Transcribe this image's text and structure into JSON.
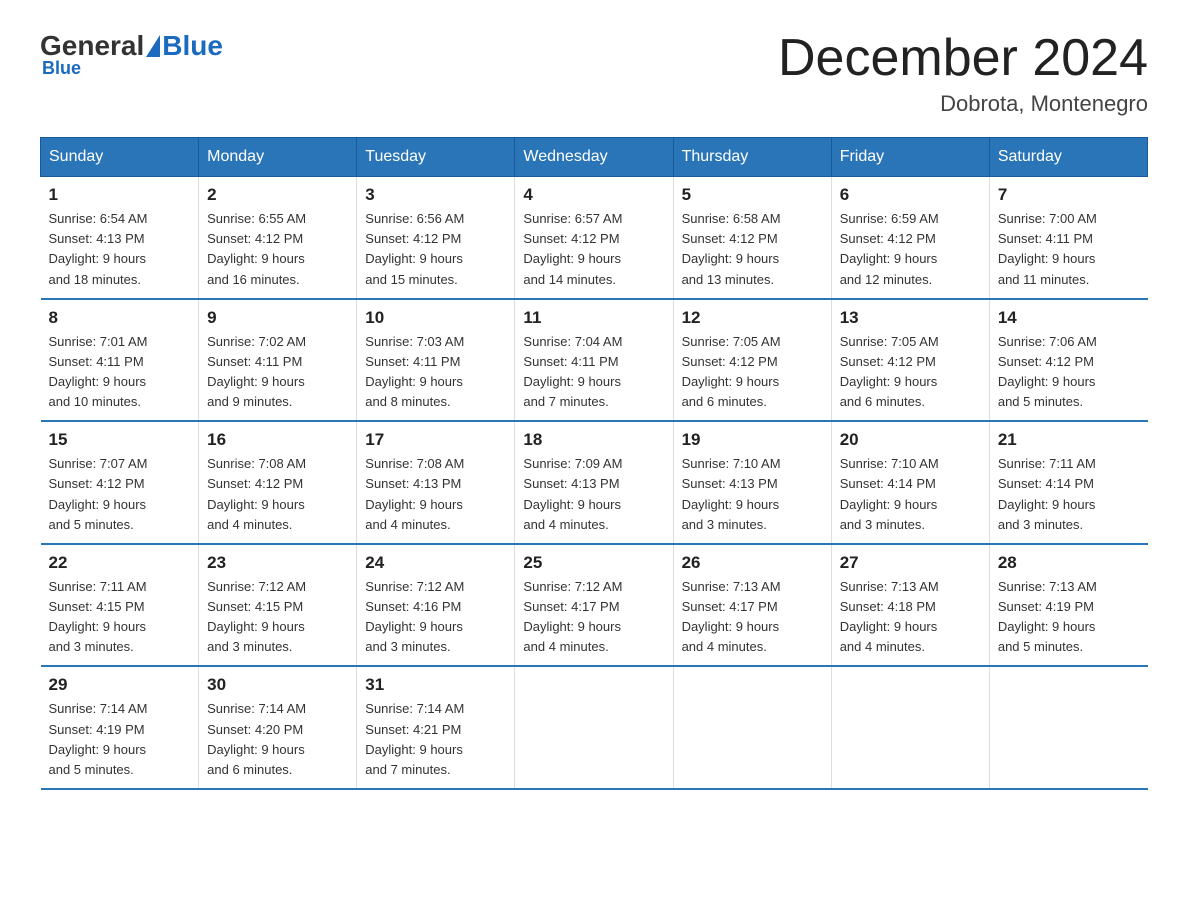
{
  "header": {
    "logo_general": "General",
    "logo_blue": "Blue",
    "month_title": "December 2024",
    "location": "Dobrota, Montenegro"
  },
  "days_of_week": [
    "Sunday",
    "Monday",
    "Tuesday",
    "Wednesday",
    "Thursday",
    "Friday",
    "Saturday"
  ],
  "weeks": [
    [
      {
        "day": "1",
        "sunrise": "6:54 AM",
        "sunset": "4:13 PM",
        "daylight": "9 hours and 18 minutes."
      },
      {
        "day": "2",
        "sunrise": "6:55 AM",
        "sunset": "4:12 PM",
        "daylight": "9 hours and 16 minutes."
      },
      {
        "day": "3",
        "sunrise": "6:56 AM",
        "sunset": "4:12 PM",
        "daylight": "9 hours and 15 minutes."
      },
      {
        "day": "4",
        "sunrise": "6:57 AM",
        "sunset": "4:12 PM",
        "daylight": "9 hours and 14 minutes."
      },
      {
        "day": "5",
        "sunrise": "6:58 AM",
        "sunset": "4:12 PM",
        "daylight": "9 hours and 13 minutes."
      },
      {
        "day": "6",
        "sunrise": "6:59 AM",
        "sunset": "4:12 PM",
        "daylight": "9 hours and 12 minutes."
      },
      {
        "day": "7",
        "sunrise": "7:00 AM",
        "sunset": "4:11 PM",
        "daylight": "9 hours and 11 minutes."
      }
    ],
    [
      {
        "day": "8",
        "sunrise": "7:01 AM",
        "sunset": "4:11 PM",
        "daylight": "9 hours and 10 minutes."
      },
      {
        "day": "9",
        "sunrise": "7:02 AM",
        "sunset": "4:11 PM",
        "daylight": "9 hours and 9 minutes."
      },
      {
        "day": "10",
        "sunrise": "7:03 AM",
        "sunset": "4:11 PM",
        "daylight": "9 hours and 8 minutes."
      },
      {
        "day": "11",
        "sunrise": "7:04 AM",
        "sunset": "4:11 PM",
        "daylight": "9 hours and 7 minutes."
      },
      {
        "day": "12",
        "sunrise": "7:05 AM",
        "sunset": "4:12 PM",
        "daylight": "9 hours and 6 minutes."
      },
      {
        "day": "13",
        "sunrise": "7:05 AM",
        "sunset": "4:12 PM",
        "daylight": "9 hours and 6 minutes."
      },
      {
        "day": "14",
        "sunrise": "7:06 AM",
        "sunset": "4:12 PM",
        "daylight": "9 hours and 5 minutes."
      }
    ],
    [
      {
        "day": "15",
        "sunrise": "7:07 AM",
        "sunset": "4:12 PM",
        "daylight": "9 hours and 5 minutes."
      },
      {
        "day": "16",
        "sunrise": "7:08 AM",
        "sunset": "4:12 PM",
        "daylight": "9 hours and 4 minutes."
      },
      {
        "day": "17",
        "sunrise": "7:08 AM",
        "sunset": "4:13 PM",
        "daylight": "9 hours and 4 minutes."
      },
      {
        "day": "18",
        "sunrise": "7:09 AM",
        "sunset": "4:13 PM",
        "daylight": "9 hours and 4 minutes."
      },
      {
        "day": "19",
        "sunrise": "7:10 AM",
        "sunset": "4:13 PM",
        "daylight": "9 hours and 3 minutes."
      },
      {
        "day": "20",
        "sunrise": "7:10 AM",
        "sunset": "4:14 PM",
        "daylight": "9 hours and 3 minutes."
      },
      {
        "day": "21",
        "sunrise": "7:11 AM",
        "sunset": "4:14 PM",
        "daylight": "9 hours and 3 minutes."
      }
    ],
    [
      {
        "day": "22",
        "sunrise": "7:11 AM",
        "sunset": "4:15 PM",
        "daylight": "9 hours and 3 minutes."
      },
      {
        "day": "23",
        "sunrise": "7:12 AM",
        "sunset": "4:15 PM",
        "daylight": "9 hours and 3 minutes."
      },
      {
        "day": "24",
        "sunrise": "7:12 AM",
        "sunset": "4:16 PM",
        "daylight": "9 hours and 3 minutes."
      },
      {
        "day": "25",
        "sunrise": "7:12 AM",
        "sunset": "4:17 PM",
        "daylight": "9 hours and 4 minutes."
      },
      {
        "day": "26",
        "sunrise": "7:13 AM",
        "sunset": "4:17 PM",
        "daylight": "9 hours and 4 minutes."
      },
      {
        "day": "27",
        "sunrise": "7:13 AM",
        "sunset": "4:18 PM",
        "daylight": "9 hours and 4 minutes."
      },
      {
        "day": "28",
        "sunrise": "7:13 AM",
        "sunset": "4:19 PM",
        "daylight": "9 hours and 5 minutes."
      }
    ],
    [
      {
        "day": "29",
        "sunrise": "7:14 AM",
        "sunset": "4:19 PM",
        "daylight": "9 hours and 5 minutes."
      },
      {
        "day": "30",
        "sunrise": "7:14 AM",
        "sunset": "4:20 PM",
        "daylight": "9 hours and 6 minutes."
      },
      {
        "day": "31",
        "sunrise": "7:14 AM",
        "sunset": "4:21 PM",
        "daylight": "9 hours and 7 minutes."
      },
      null,
      null,
      null,
      null
    ]
  ],
  "labels": {
    "sunrise": "Sunrise:",
    "sunset": "Sunset:",
    "daylight": "Daylight:"
  }
}
